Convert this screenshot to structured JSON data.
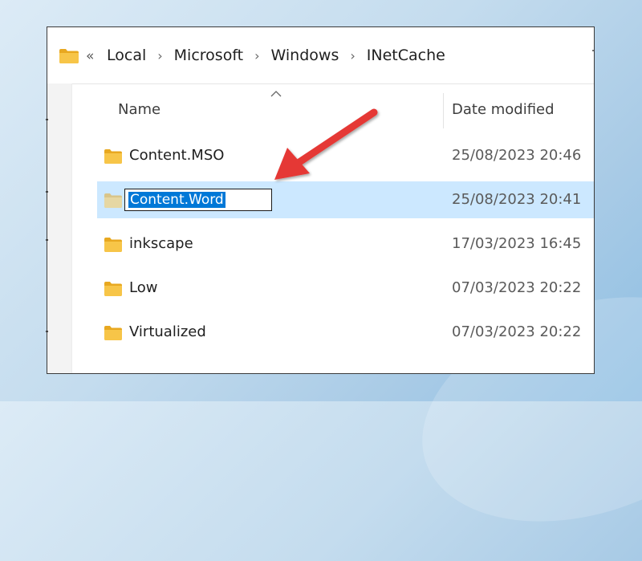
{
  "breadcrumb": {
    "overflow": "«",
    "items": [
      "Local",
      "Microsoft",
      "Windows",
      "INetCache"
    ],
    "separator": "›"
  },
  "columns": {
    "name": "Name",
    "date_modified": "Date modified"
  },
  "rows": [
    {
      "name": "Content.MSO",
      "date": "25/08/2023 20:46",
      "selected": false
    },
    {
      "name": "Content.Word",
      "date": "25/08/2023 20:41",
      "selected": true,
      "renaming": true
    },
    {
      "name": "inkscape",
      "date": "17/03/2023 16:45",
      "selected": false
    },
    {
      "name": "Low",
      "date": "07/03/2023 20:22",
      "selected": false
    },
    {
      "name": "Virtualized",
      "date": "07/03/2023 20:22",
      "selected": false
    }
  ],
  "colors": {
    "selection": "#cce8ff",
    "text_highlight": "#0078d7",
    "arrow": "#e53935",
    "folder": "#f7c548"
  },
  "icons": {
    "folder": "folder-icon",
    "sort": "sort-up-caret-icon",
    "annotation": "red-arrow-annotation"
  }
}
